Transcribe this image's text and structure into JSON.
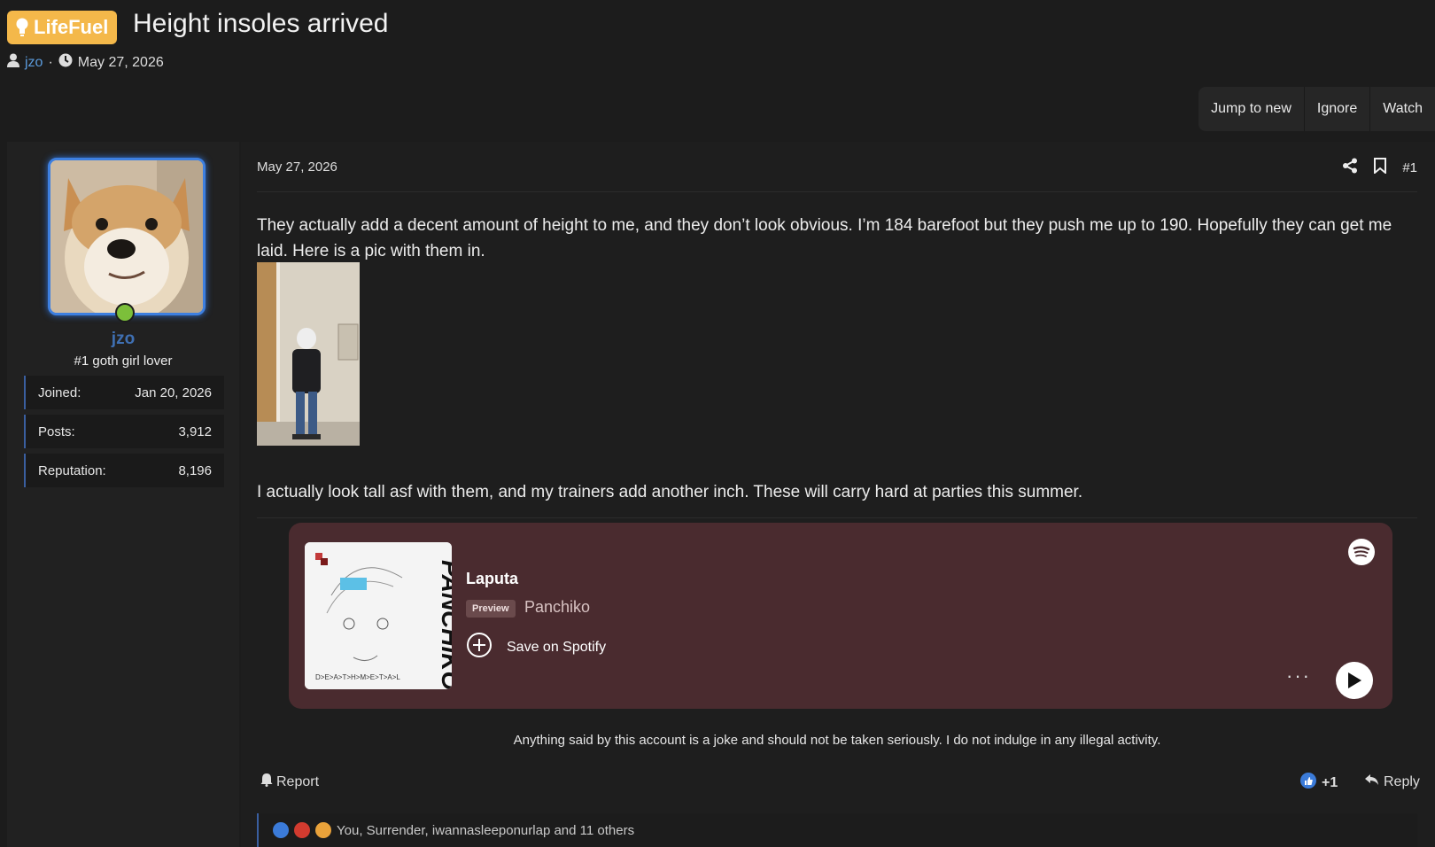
{
  "thread": {
    "prefix": "LifeFuel",
    "prefix_color": "#f4b84a",
    "title": "Height insoles arrived",
    "author": "jzo",
    "date": "May 27, 2026"
  },
  "thread_buttons": [
    "Jump to new",
    "Ignore",
    "Watch"
  ],
  "user": {
    "name": "jzo",
    "user_title": "#1 goth girl lover",
    "stats": [
      {
        "label": "Joined:",
        "value": "Jan 20, 2026"
      },
      {
        "label": "Posts:",
        "value": "3,912"
      },
      {
        "label": "Reputation:",
        "value": "8,196"
      }
    ]
  },
  "post": {
    "date": "May 27, 2026",
    "number": "#1",
    "paragraph1": "They actually add a decent amount of height to me, and they don’t look obvious. I’m 184 barefoot but they push me up to 190. Hopefully they can get me laid. Here is a pic with them in.",
    "paragraph2": "I actually look tall asf with them, and my trainers add another inch. These will carry hard at parties this summer.",
    "signature": "Anything said by this account is a joke and should not be taken seriously. I do not indulge in any illegal activity."
  },
  "spotify": {
    "track": "Laputa",
    "badge": "Preview",
    "artist": "Panchiko",
    "save_label": "Save on Spotify",
    "cover_text": "PANCHIKO",
    "cover_subtext": "D>E>A>T>H>M>E>T>A>L",
    "more_label": "···"
  },
  "footer": {
    "report_label": "Report",
    "like_label": "+1",
    "reply_label": "Reply",
    "reactions_text": "You, Surrender, iwannasleeponurlap and 11 others"
  },
  "colors": {
    "accent": "#3d7fe0",
    "online": "#7cbf3a",
    "spotify_bg": "#4a2b2f"
  }
}
